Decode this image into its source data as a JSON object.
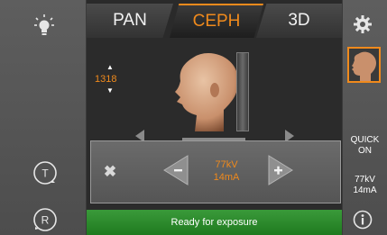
{
  "tabs": [
    {
      "label": "PAN"
    },
    {
      "label": "CEPH"
    },
    {
      "label": "3D"
    }
  ],
  "active_tab": "CEPH",
  "height": {
    "value": "1318",
    "up_glyph": "▲",
    "down_glyph": "▼"
  },
  "exposure": {
    "kv": "77kV",
    "ma": "14mA"
  },
  "right_panel": {
    "quick_line1": "QUICK",
    "quick_line2": "ON",
    "kv": "77kV",
    "ma": "14mA"
  },
  "status": {
    "text": "Ready for exposure"
  },
  "buttons": {
    "t_label": "T",
    "r_label": "R",
    "close_glyph": "✖"
  },
  "colors": {
    "accent": "#f08a1c",
    "status_green": "#2a8c2a",
    "panel": "#555555"
  },
  "icons": [
    "light-bulb-icon",
    "gear-icon",
    "patient-thumbnail-icon",
    "info-icon",
    "minus-arrow-icon",
    "plus-arrow-icon",
    "close-icon",
    "t-rotate-icon",
    "r-rotate-icon"
  ]
}
